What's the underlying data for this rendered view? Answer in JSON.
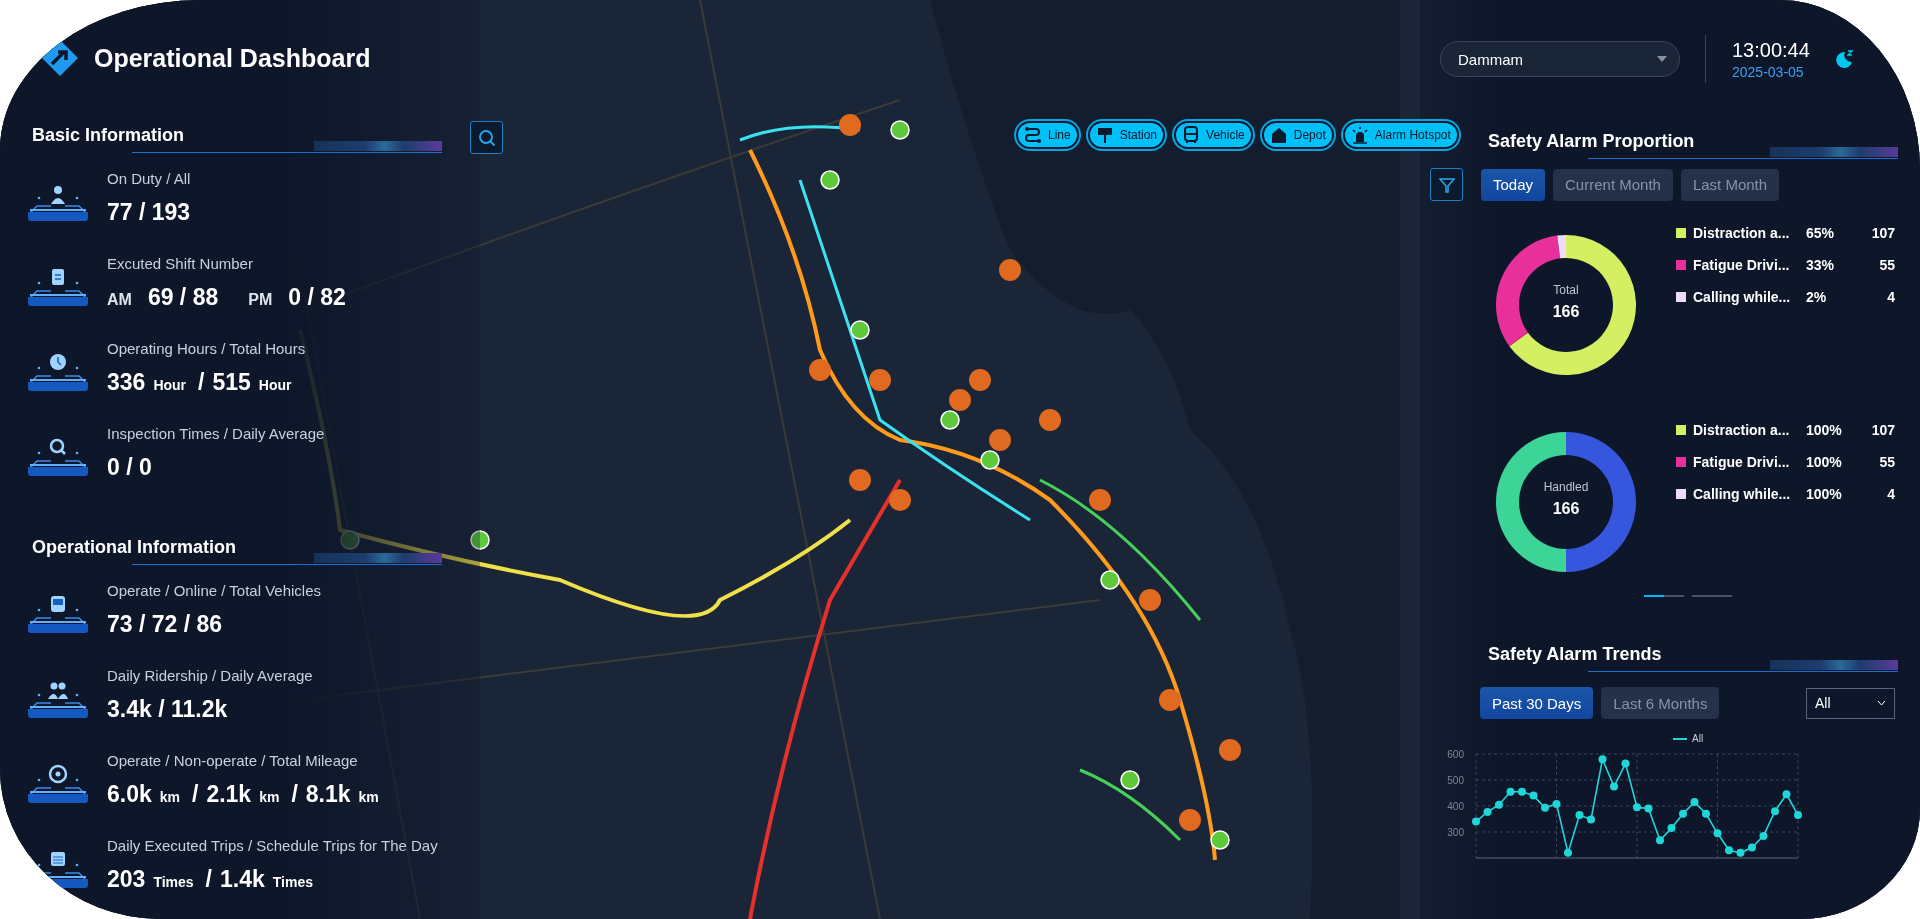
{
  "header": {
    "title": "Operational Dashboard"
  },
  "basic_information": {
    "title": "Basic Information",
    "stats": [
      {
        "label": "On Duty / All",
        "value": [
          {
            "kind": "number",
            "text": "77 / 193"
          }
        ]
      },
      {
        "label": "Excuted Shift Number",
        "value": [
          {
            "kind": "tag",
            "text": "AM"
          },
          {
            "kind": "number",
            "text": "69 / 88"
          },
          {
            "kind": "tag",
            "text": "PM"
          },
          {
            "kind": "number",
            "text": "0 / 82"
          }
        ]
      },
      {
        "label": "Operating Hours / Total Hours",
        "value": [
          {
            "kind": "number",
            "text": "336"
          },
          {
            "kind": "unit",
            "text": "Hour"
          },
          {
            "kind": "sep",
            "text": "/"
          },
          {
            "kind": "number",
            "text": "515"
          },
          {
            "kind": "unit",
            "text": "Hour"
          }
        ]
      },
      {
        "label": "Inspection Times / Daily Average",
        "value": [
          {
            "kind": "number",
            "text": "0 / 0"
          }
        ]
      }
    ]
  },
  "operational_information": {
    "title": "Operational Information",
    "stats": [
      {
        "label": "Operate / Online / Total Vehicles",
        "value": [
          {
            "kind": "number",
            "text": "73 / 72 / 86"
          }
        ]
      },
      {
        "label": "Daily Ridership / Daily Average",
        "value": [
          {
            "kind": "number",
            "text": "3.4k / 11.2k"
          }
        ]
      },
      {
        "label": "Operate / Non-operate / Total Mileage",
        "value": [
          {
            "kind": "number",
            "text": "6.0k"
          },
          {
            "kind": "unit",
            "text": "km"
          },
          {
            "kind": "sep",
            "text": "/"
          },
          {
            "kind": "number",
            "text": "2.1k"
          },
          {
            "kind": "unit",
            "text": "km"
          },
          {
            "kind": "sep",
            "text": "/"
          },
          {
            "kind": "number",
            "text": "8.1k"
          },
          {
            "kind": "unit",
            "text": "km"
          }
        ]
      },
      {
        "label": "Daily Executed Trips / Schedule Trips for The Day",
        "value": [
          {
            "kind": "number",
            "text": "203"
          },
          {
            "kind": "unit",
            "text": "Times"
          },
          {
            "kind": "sep",
            "text": "/"
          },
          {
            "kind": "number",
            "text": "1.4k"
          },
          {
            "kind": "unit",
            "text": "Times"
          }
        ]
      }
    ]
  },
  "map_toolbar": [
    {
      "label": "Line"
    },
    {
      "label": "Station"
    },
    {
      "label": "Vehicle"
    },
    {
      "label": "Depot"
    },
    {
      "label": "Alarm Hotspot"
    }
  ],
  "city_select": {
    "value": "Dammam"
  },
  "clock": {
    "time": "13:00:44",
    "date": "2025-03-05"
  },
  "safety_alarm_proportion": {
    "title": "Safety Alarm Proportion",
    "tabs": [
      {
        "label": "Today",
        "selected": true
      },
      {
        "label": "Current Month",
        "selected": false
      },
      {
        "label": "Last Month",
        "selected": false
      }
    ],
    "panels": [
      {
        "center_label": "Total",
        "center_value": "166",
        "chart_data": {
          "type": "donut",
          "values": [
            65,
            33,
            2
          ],
          "colors": [
            "#d4f062",
            "#e8309a",
            "#ecdcfa"
          ]
        },
        "legend": [
          {
            "name": "Distraction a...",
            "percent": "65%",
            "count": "107",
            "color": "#d4f062"
          },
          {
            "name": "Fatigue Drivi...",
            "percent": "33%",
            "count": "55",
            "color": "#e8309a"
          },
          {
            "name": "Calling while...",
            "percent": "2%",
            "count": "4",
            "color": "#ecdcfa"
          }
        ]
      },
      {
        "center_label": "Handled",
        "center_value": "166",
        "chart_data": {
          "type": "donut",
          "values": [
            50,
            50
          ],
          "colors": [
            "#3556dd",
            "#3dd497"
          ]
        },
        "legend": [
          {
            "name": "Distraction a...",
            "percent": "100%",
            "count": "107",
            "color": "#d4f062"
          },
          {
            "name": "Fatigue Drivi...",
            "percent": "100%",
            "count": "55",
            "color": "#e8309a"
          },
          {
            "name": "Calling while...",
            "percent": "100%",
            "count": "4",
            "color": "#ecdcfa"
          }
        ]
      }
    ],
    "pagination": [
      {
        "selected": true
      },
      {
        "selected": false
      }
    ]
  },
  "safety_alarm_trends": {
    "title": "Safety Alarm Trends",
    "tabs": [
      {
        "label": "Past 30 Days",
        "selected": true
      },
      {
        "label": "Last 6 Months",
        "selected": false
      }
    ],
    "filter": {
      "value": "All"
    },
    "chart_data": {
      "type": "line",
      "ylim": [
        200,
        600
      ],
      "yticks": [
        300,
        400,
        500,
        600
      ],
      "grid": true,
      "series": [
        {
          "name": "All",
          "color": "#1fd6d9",
          "marker": "circle",
          "values": [
            340,
            377,
            405,
            455,
            455,
            440,
            393,
            408,
            220,
            365,
            348,
            580,
            475,
            563,
            395,
            390,
            268,
            315,
            370,
            415,
            370,
            295,
            230,
            220,
            240,
            285,
            380,
            445,
            365
          ]
        }
      ]
    }
  }
}
